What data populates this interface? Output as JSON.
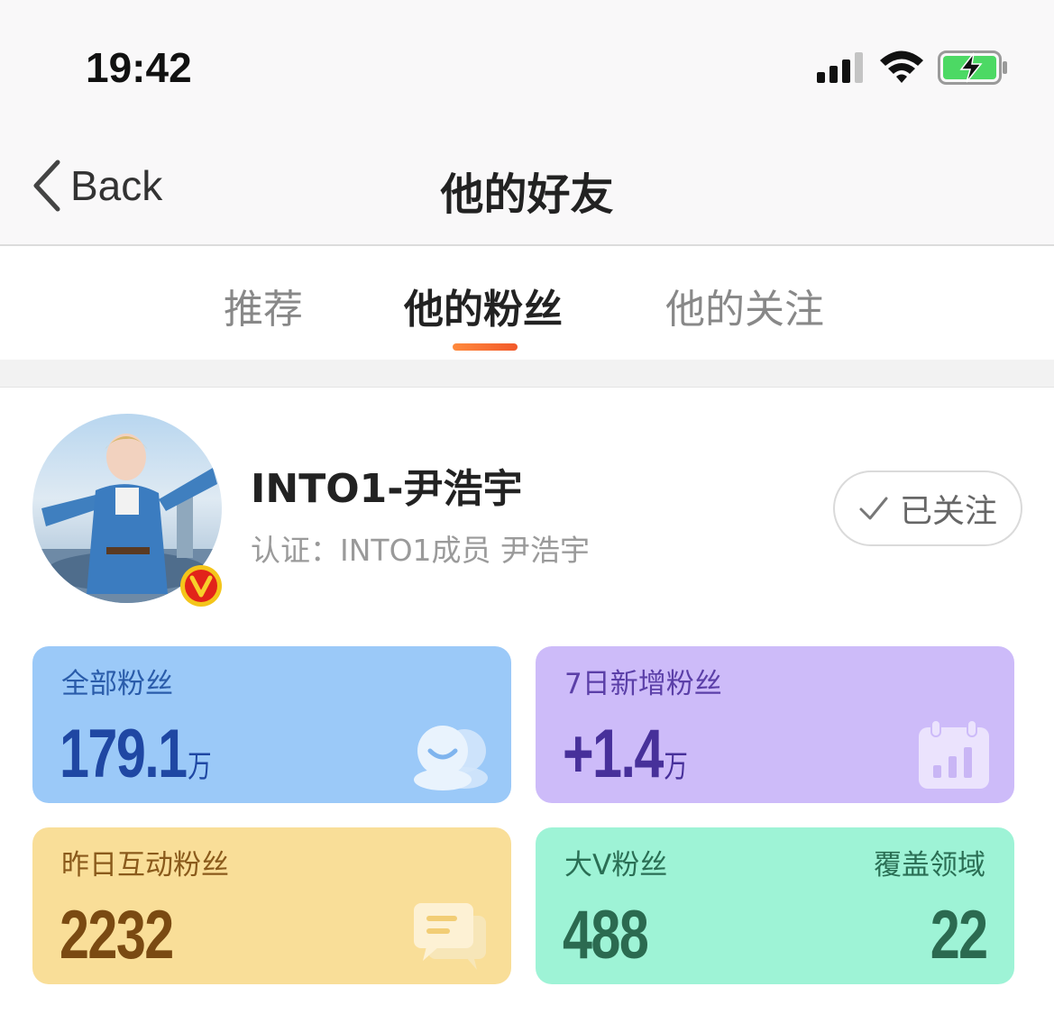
{
  "status_bar": {
    "time": "19:42",
    "icons": [
      "signal-icon",
      "wifi-icon",
      "battery-charging-icon"
    ],
    "battery_color": "#4cd964"
  },
  "nav": {
    "back_label": "Back",
    "title": "他的好友"
  },
  "tabs": [
    {
      "label": "推荐",
      "active": false
    },
    {
      "label": "他的粉丝",
      "active": true
    },
    {
      "label": "他的关注",
      "active": false
    }
  ],
  "accent_color": "#f2592a",
  "profile": {
    "name": "INTO1-尹浩宇",
    "verification": "认证：INTO1成员 尹浩宇",
    "badge_icon": "verified-v-icon",
    "follow_label": "已关注"
  },
  "stats": {
    "total_fans": {
      "title": "全部粉丝",
      "value": "179.1",
      "unit": "万",
      "icon": "fans-icon",
      "color": "#9bc9f8"
    },
    "new_fans_7d": {
      "title": "7日新增粉丝",
      "value": "+1.4",
      "unit": "万",
      "icon": "calendar-chart-icon",
      "color": "#cdbbf9"
    },
    "yesterday_interactive": {
      "title": "昨日互动粉丝",
      "value": "2232",
      "icon": "message-icon",
      "color": "#f9de98"
    },
    "big_v_fans": {
      "title": "大V粉丝",
      "value": "488",
      "color": "#9ef3d6"
    },
    "coverage": {
      "title": "覆盖领域",
      "value": "22"
    }
  }
}
